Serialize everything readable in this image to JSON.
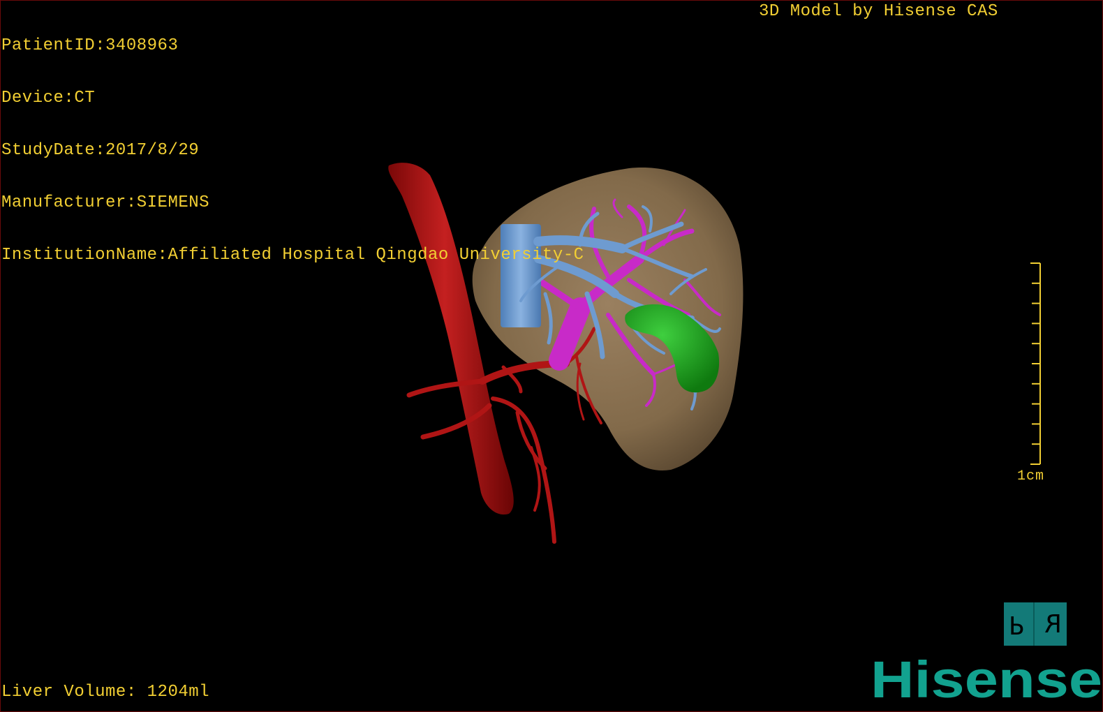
{
  "info": {
    "patient_id": "PatientID:3408963",
    "device": "Device:CT",
    "study_date": "StudyDate:2017/8/29",
    "manufacturer": "Manufacturer:SIEMENS",
    "institution": "InstitutionName:Affiliated Hospital Qingdao University-C"
  },
  "watermark_title": "3D Model by Hisense CAS",
  "volume_readout": "Liver Volume: 1204ml",
  "scale": {
    "label": "1cm",
    "tick_count": 11
  },
  "orientation": {
    "left_face": "P",
    "right_face": "R"
  },
  "brand": {
    "name": "Hisense",
    "color": "#12a28f"
  },
  "colors": {
    "overlay_text": "#f2cf33",
    "liver": "#8a7352",
    "aorta": "#b01515",
    "portal_vein": "#c82ac8",
    "hepatic_vein": "#6e9bd0",
    "gallbladder": "#1a9a1a"
  },
  "icons": {
    "orientation": "orientation-cube-icon",
    "scale": "scale-bar-icon"
  }
}
